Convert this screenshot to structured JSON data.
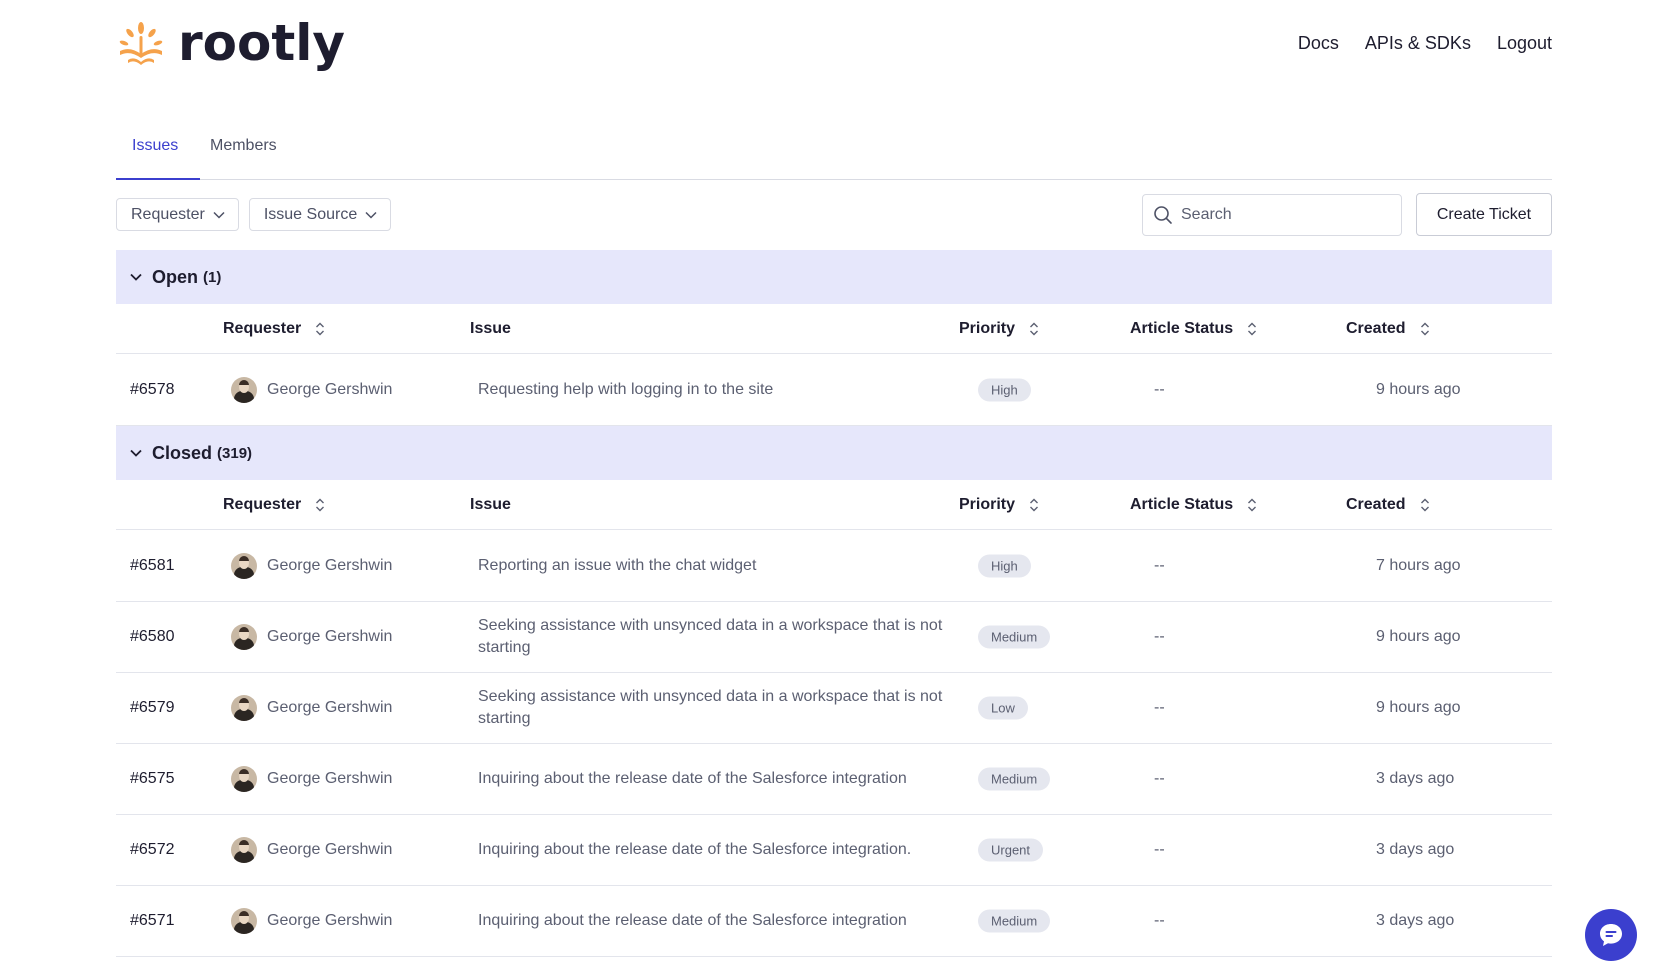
{
  "brand": {
    "name": "rootly",
    "accent": "#3b3fce",
    "logo_color": "#f5a24b"
  },
  "topnav": [
    "Docs",
    "APIs & SDKs",
    "Logout"
  ],
  "tabs": [
    {
      "label": "Issues",
      "active": true
    },
    {
      "label": "Members",
      "active": false
    }
  ],
  "filters": {
    "requester": "Requester",
    "issue_source": "Issue Source"
  },
  "search": {
    "placeholder": "Search",
    "icon": "search-icon"
  },
  "create_ticket": "Create Ticket",
  "columns": {
    "requester": "Requester",
    "issue": "Issue",
    "priority": "Priority",
    "article_status": "Article Status",
    "created": "Created"
  },
  "groups": {
    "open": {
      "title": "Open",
      "count": "(1)",
      "rows": [
        {
          "id": "#6578",
          "requester": "George Gershwin",
          "issue": "Requesting help with logging in to the site",
          "priority": "High",
          "article_status": "--",
          "created": "9 hours ago"
        }
      ]
    },
    "closed": {
      "title": "Closed",
      "count": "(319)",
      "rows": [
        {
          "id": "#6581",
          "requester": "George Gershwin",
          "issue": "Reporting an issue with the chat widget",
          "priority": "High",
          "article_status": "--",
          "created": "7 hours ago"
        },
        {
          "id": "#6580",
          "requester": "George Gershwin",
          "issue": "Seeking assistance with unsynced data in a workspace that is not starting",
          "priority": "Medium",
          "article_status": "--",
          "created": "9 hours ago"
        },
        {
          "id": "#6579",
          "requester": "George Gershwin",
          "issue": "Seeking assistance with unsynced data in a workspace that is not starting",
          "priority": "Low",
          "article_status": "--",
          "created": "9 hours ago"
        },
        {
          "id": "#6575",
          "requester": "George Gershwin",
          "issue": "Inquiring about the release date of the Salesforce integration",
          "priority": "Medium",
          "article_status": "--",
          "created": "3 days ago"
        },
        {
          "id": "#6572",
          "requester": "George Gershwin",
          "issue": "Inquiring about the release date of the Salesforce integration.",
          "priority": "Urgent",
          "article_status": "--",
          "created": "3 days ago"
        },
        {
          "id": "#6571",
          "requester": "George Gershwin",
          "issue": "Inquiring about the release date of the Salesforce integration",
          "priority": "Medium",
          "article_status": "--",
          "created": "3 days ago"
        }
      ]
    }
  },
  "chat_widget": {
    "icon": "chat-icon"
  }
}
